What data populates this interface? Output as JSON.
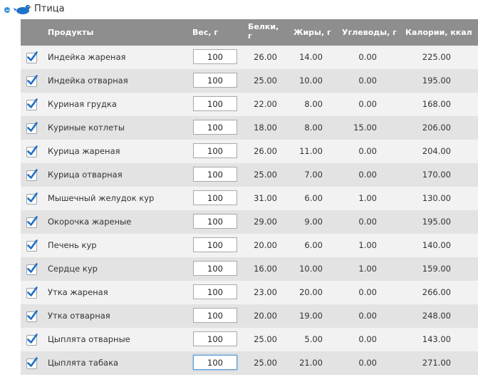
{
  "section": {
    "title": "Птица",
    "collapse_icon": "minus-circle-icon",
    "category_icon": "bird-icon"
  },
  "colors": {
    "header_bg": "#8e8e8e",
    "row_odd": "#f2f2f2",
    "row_even": "#e3e3e3",
    "check": "#1f6fc4",
    "accent": "#3a8fd6"
  },
  "table": {
    "headers": {
      "product": "Продукты",
      "weight": "Вес, г",
      "protein": "Белки, г",
      "fat": "Жиры, г",
      "carbs": "Углеводы, г",
      "kcal": "Калории, ккал"
    },
    "rows": [
      {
        "name": "Индейка жареная",
        "weight": "100",
        "protein": "26.00",
        "fat": "14.00",
        "carbs": "0.00",
        "kcal": "225.00",
        "checked": true
      },
      {
        "name": "Индейка отварная",
        "weight": "100",
        "protein": "25.00",
        "fat": "10.00",
        "carbs": "0.00",
        "kcal": "195.00",
        "checked": true
      },
      {
        "name": "Куриная грудка",
        "weight": "100",
        "protein": "22.00",
        "fat": "8.00",
        "carbs": "0.00",
        "kcal": "168.00",
        "checked": true
      },
      {
        "name": "Куриные котлеты",
        "weight": "100",
        "protein": "18.00",
        "fat": "8.00",
        "carbs": "15.00",
        "kcal": "206.00",
        "checked": true
      },
      {
        "name": "Курица жареная",
        "weight": "100",
        "protein": "26.00",
        "fat": "11.00",
        "carbs": "0.00",
        "kcal": "204.00",
        "checked": true
      },
      {
        "name": "Курица отварная",
        "weight": "100",
        "protein": "25.00",
        "fat": "7.00",
        "carbs": "0.00",
        "kcal": "170.00",
        "checked": true
      },
      {
        "name": "Мышечный желудок кур",
        "weight": "100",
        "protein": "31.00",
        "fat": "6.00",
        "carbs": "1.00",
        "kcal": "130.00",
        "checked": true
      },
      {
        "name": "Окорочка жареные",
        "weight": "100",
        "protein": "29.00",
        "fat": "9.00",
        "carbs": "0.00",
        "kcal": "195.00",
        "checked": true
      },
      {
        "name": "Печень кур",
        "weight": "100",
        "protein": "20.00",
        "fat": "6.00",
        "carbs": "1.00",
        "kcal": "140.00",
        "checked": true
      },
      {
        "name": "Сердце кур",
        "weight": "100",
        "protein": "16.00",
        "fat": "10.00",
        "carbs": "1.00",
        "kcal": "159.00",
        "checked": true
      },
      {
        "name": "Утка жареная",
        "weight": "100",
        "protein": "23.00",
        "fat": "20.00",
        "carbs": "0.00",
        "kcal": "266.00",
        "checked": true
      },
      {
        "name": "Утка отварная",
        "weight": "100",
        "protein": "20.00",
        "fat": "19.00",
        "carbs": "0.00",
        "kcal": "248.00",
        "checked": true
      },
      {
        "name": "Цыплята отварные",
        "weight": "100",
        "protein": "25.00",
        "fat": "5.00",
        "carbs": "0.00",
        "kcal": "143.00",
        "checked": true
      },
      {
        "name": "Цыплята табака",
        "weight": "100",
        "protein": "25.00",
        "fat": "21.00",
        "carbs": "0.00",
        "kcal": "271.00",
        "checked": true,
        "focused": true
      }
    ]
  }
}
